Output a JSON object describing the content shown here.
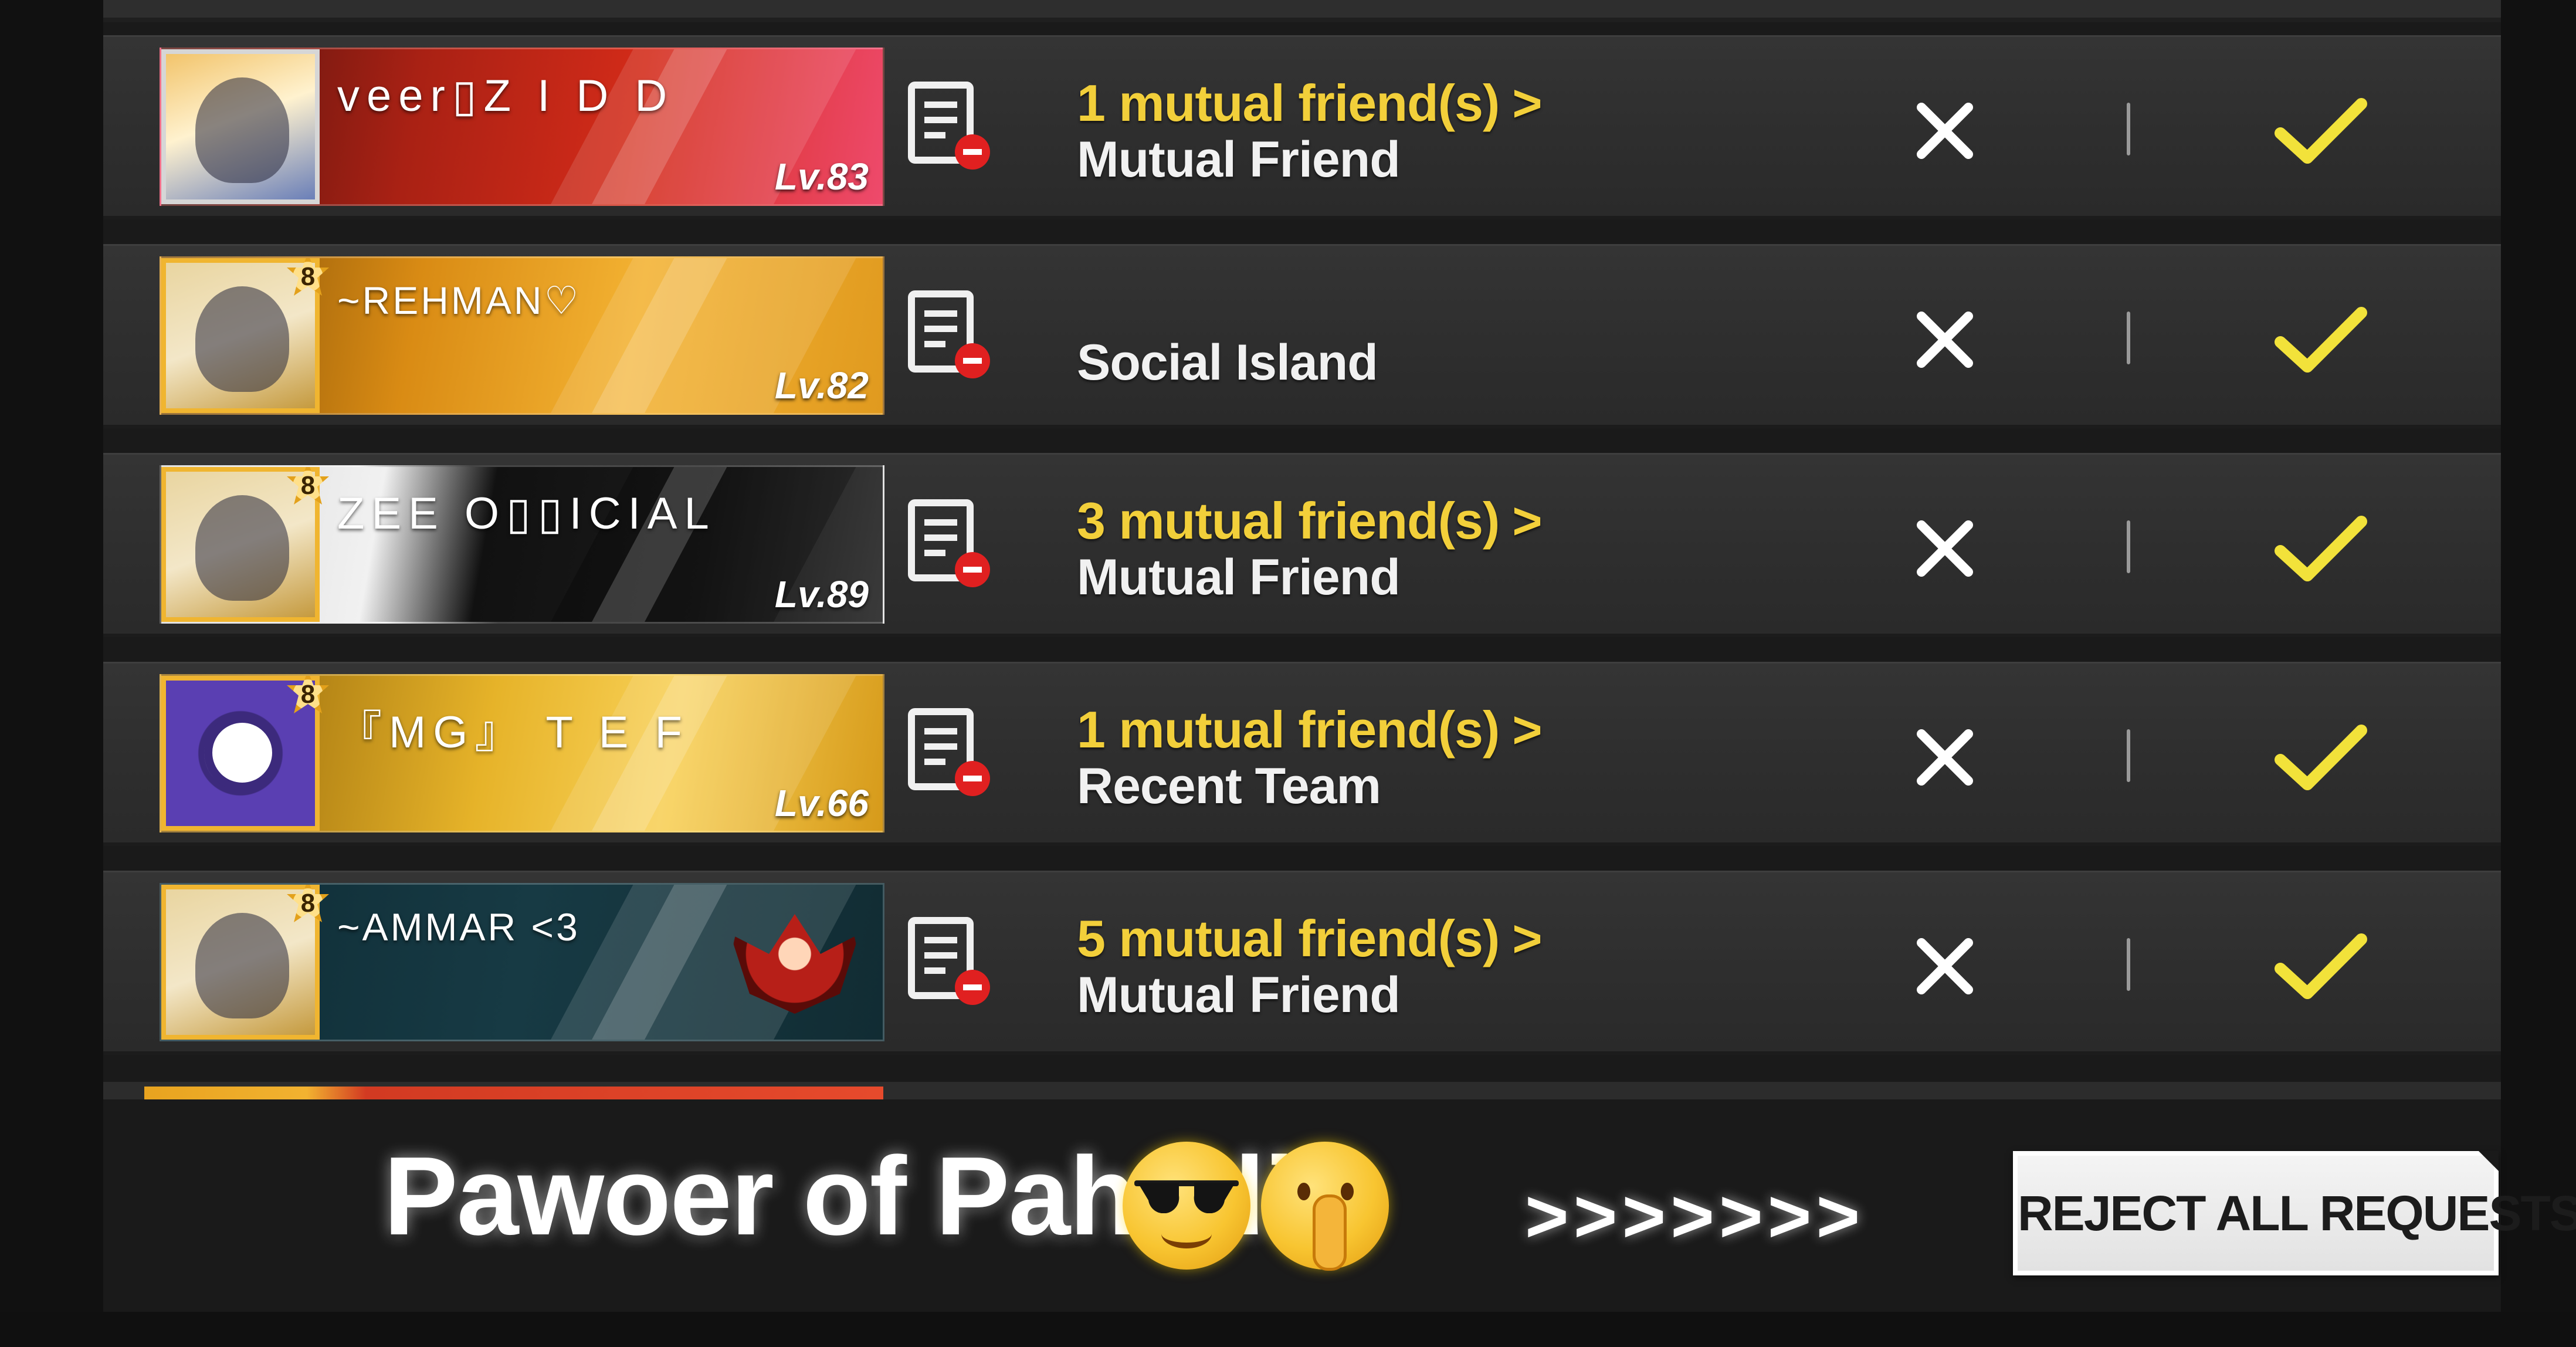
{
  "requests": [
    {
      "player_name": "veer▯Z I D D",
      "level": "Lv.83",
      "mutual": "1 mutual friend(s)",
      "source": "Mutual Friend",
      "card_style": "red",
      "avatar_style": "plain"
    },
    {
      "player_name": "~REHMAN♡",
      "level": "Lv.82",
      "mutual": "",
      "source": "Social Island",
      "card_style": "gold",
      "avatar_style": "gold"
    },
    {
      "player_name": "ZEE O▯▯ICIAL",
      "level": "Lv.89",
      "mutual": "3 mutual friend(s)",
      "source": "Mutual Friend",
      "card_style": "bw",
      "avatar_style": "gold"
    },
    {
      "player_name": "『MG』 T E F",
      "level": "Lv.66",
      "mutual": "1 mutual friend(s)",
      "source": "Recent Team",
      "card_style": "gold2",
      "avatar_style": "purple"
    },
    {
      "player_name": "~AMMAR <3",
      "level": "",
      "mutual": "5 mutual friend(s)",
      "source": "Mutual Friend",
      "card_style": "teal",
      "avatar_style": "gold"
    }
  ],
  "badge_label": "8",
  "chevron": ">",
  "reject_all_label": "REJECT ALL REQUESTS",
  "overlay_caption": "Pawoer of Pahadi",
  "overlay_emojis": [
    "smiling-face-with-sunglasses",
    "shushing-face"
  ],
  "overlay_arrows": ">>>>>>>",
  "icons": {
    "details": "profile-details-icon",
    "reject": "close-icon",
    "accept": "checkmark-icon"
  },
  "colors": {
    "background": "#1a1a1a",
    "row": "#2f2f2f",
    "mutual_text": "#f2cf3a",
    "accept_check": "#f2e23a",
    "reject_x": "#ffffff",
    "badge_red": "#e02020"
  }
}
